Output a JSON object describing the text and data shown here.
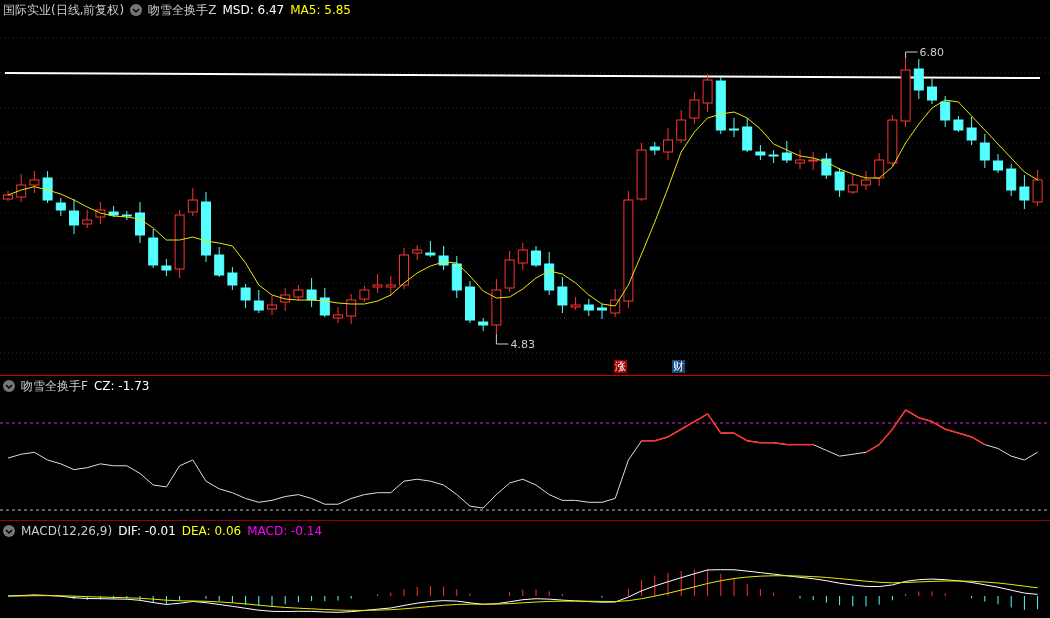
{
  "main_panel": {
    "instrument": "国际实业(日线,前复权)",
    "indicator": "吻雪全换手Z",
    "readings": [
      {
        "label": "MSD: 6.47",
        "color": "#ffffff"
      },
      {
        "label": "MA5: 5.85",
        "color": "#ffff00"
      }
    ],
    "high_label": "6.80",
    "low_label": "4.83",
    "markers": [
      {
        "text": "涨",
        "color": "#a00000"
      },
      {
        "text": "财",
        "color": "#164a7e"
      }
    ]
  },
  "turnover_panel": {
    "indicator": "吻雪全换手F",
    "readings": [
      {
        "label": "CZ: -1.73",
        "color": "#ffffff"
      }
    ]
  },
  "macd_panel": {
    "indicator": "MACD(12,26,9)",
    "readings": [
      {
        "label": "DIF: -0.01",
        "color": "#ffffff"
      },
      {
        "label": "DEA: 0.06",
        "color": "#ffff00"
      },
      {
        "label": "MACD: -0.14",
        "color": "#ff00ff"
      }
    ]
  }
}
